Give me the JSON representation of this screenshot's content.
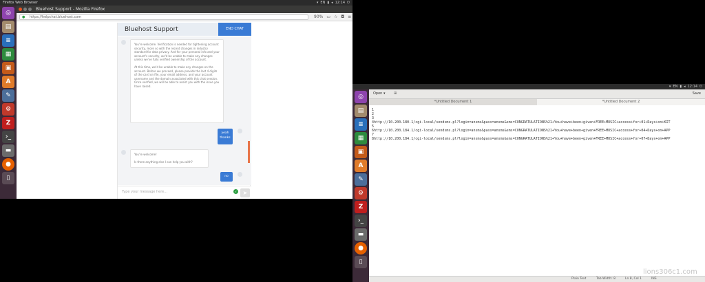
{
  "left": {
    "topbar_title": "Firefox Web Browser",
    "window_title": "Bluehost Support - Mozilla Firefox",
    "url": "https://helpchat.bluehost.com",
    "tray": [
      "wifi-icon",
      "arrow-icon",
      "keyboard-icon",
      "battery-icon",
      "volume-icon",
      "clock"
    ],
    "tray_text": [
      "EN",
      "12:14"
    ],
    "nav_text": "90%",
    "chat": {
      "title": "Bluehost Support",
      "end_chat": "END CHAT",
      "agent_msg_1": [
        "You're welcome. Verification is needed for tightening account security, more so with the recent changes in industry standard for data privacy. And for your personal info and your account's security, we'd be unable to make any changes unless we've fully verified ownership of the account.",
        "At this time, we'd be unable to make any changes on the account. Before we proceed, please provide the last 4 digits of the card on file, your email address, and your account username and the domain associated with this chat session. Once verified, we will be able to assist you with the issue you have raised."
      ],
      "user_msg_1": "yeah thanks",
      "agent_msg_2": [
        "You're welcome!",
        "Is there anything else I can help you with?"
      ],
      "user_msg_2": "no",
      "input_placeholder": "Type your message here...",
      "send_icon": "send-icon"
    },
    "launcher_icons": [
      "ubuntu-logo-icon",
      "files-icon",
      "writer-icon",
      "calc-icon",
      "impress-icon",
      "software-center-icon",
      "tools-icon",
      "settings-icon",
      "filezilla-icon",
      "terminal-icon",
      "usb-icon",
      "firefox-icon",
      "trash-icon"
    ]
  },
  "right": {
    "tray_text": [
      "EN",
      "12:14"
    ],
    "open_label": "Open",
    "save_label": "Save",
    "tabs": [
      "*Untitled Document 1",
      "*Untitled Document 2"
    ],
    "lines": [
      "1",
      "2",
      "3",
      "4http://10.200.180.1/cgi-local/sendsms.pl?login=ansms&pass=ansms&sms=CONGRATULATIONS%21+You+have+been+given+FREE+MUSIC+access+for+01+Days+on+KIT",
      "5",
      "6http://10.200.184.1/cgi-local/sendsms.pl?login=ansms&pass=ansms&sms=CONGRATULATIONS%21+You+have+been+given+FREE+MUSIC+access+for+04+Days+on+APP",
      "7",
      "8http://10.200.184.1/cgi-local/sendsms.pl?login=ansms&pass=ansms&sms=CONGRATULATIONS%21+You+have+been+given+FREE+MUSIC+access+for+07+Days+on+APP"
    ],
    "status": [
      "Plain Text",
      "Tab Width: 8",
      "Ln 8, Col 1",
      "INS"
    ],
    "watermark": "lions306c1.com",
    "launcher_icons": [
      "ubuntu-logo-icon",
      "files-icon",
      "writer-icon",
      "calc-icon",
      "impress-icon",
      "software-center-icon",
      "tools-icon",
      "settings-icon",
      "filezilla-icon",
      "terminal-icon",
      "usb-icon",
      "firefox-icon",
      "trash-icon"
    ]
  },
  "colors": {
    "launcher": "#3c2a38",
    "accent": "#3a7bd5",
    "scroll_marker": "#e8764b"
  }
}
